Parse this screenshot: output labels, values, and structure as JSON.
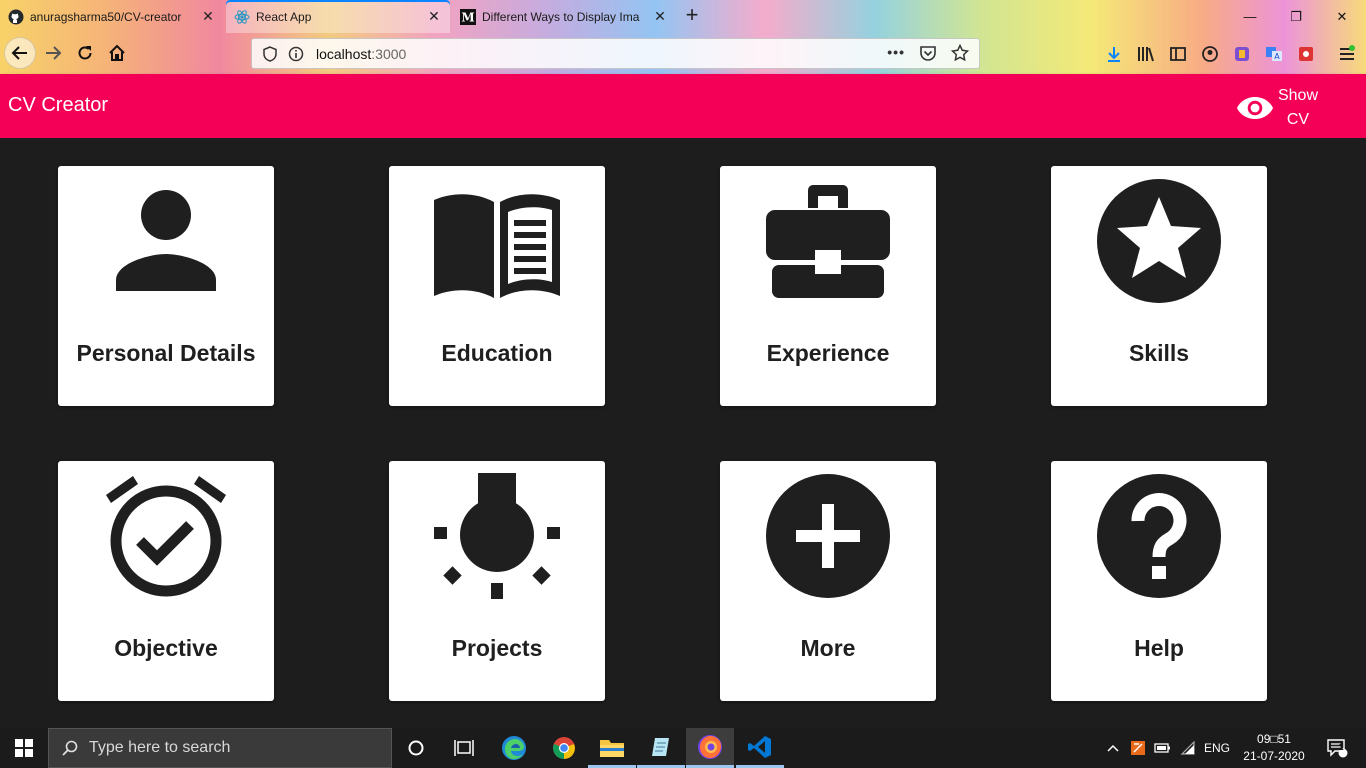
{
  "browser": {
    "tabs": [
      {
        "title": "anuragsharma50/CV-creator",
        "favicon": "github-icon",
        "active": false
      },
      {
        "title": "React App",
        "favicon": "react-icon",
        "active": true
      },
      {
        "title": "Different Ways to Display Ima",
        "favicon": "medium-icon",
        "active": false
      }
    ],
    "url": {
      "host": "localhost",
      "port": ":3000"
    }
  },
  "app": {
    "title": "CV Creator",
    "show_cv_line1": "Show",
    "show_cv_line2": "CV",
    "colors": {
      "accent": "#f50057",
      "background": "#1d1d1d",
      "card": "#ffffff",
      "icon": "#1f1f1f"
    }
  },
  "sections": [
    {
      "label": "Personal Details",
      "icon": "person-icon"
    },
    {
      "label": "Education",
      "icon": "book-icon"
    },
    {
      "label": "Experience",
      "icon": "briefcase-icon"
    },
    {
      "label": "Skills",
      "icon": "star-icon"
    },
    {
      "label": "Objective",
      "icon": "alarm-check-icon"
    },
    {
      "label": "Projects",
      "icon": "lightbulb-icon"
    },
    {
      "label": "More",
      "icon": "add-circle-icon"
    },
    {
      "label": "Help",
      "icon": "help-icon"
    }
  ],
  "taskbar": {
    "search_placeholder": "Type here to search",
    "language": "ENG",
    "time": "09□51",
    "date": "21-07-2020",
    "notification_count": "1"
  }
}
